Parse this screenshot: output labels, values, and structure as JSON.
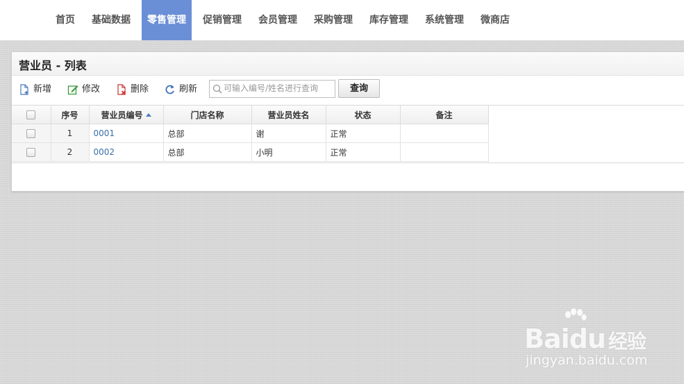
{
  "nav": {
    "items": [
      "首页",
      "基础数据",
      "零售管理",
      "促销管理",
      "会员管理",
      "采购管理",
      "库存管理",
      "系统管理",
      "微商店"
    ],
    "active_index": 2,
    "active_color": "#6a8fd6"
  },
  "panel": {
    "title": "营业员 - 列表"
  },
  "toolbar": {
    "add_label": "新增",
    "edit_label": "修改",
    "delete_label": "删除",
    "refresh_label": "刷新",
    "search_placeholder": "可输入编号/姓名进行查询",
    "search_value": "",
    "query_label": "查询"
  },
  "icons": {
    "add": "file-plus-icon",
    "edit": "edit-icon",
    "delete": "file-delete-icon",
    "refresh": "refresh-icon",
    "search": "search-icon"
  },
  "table": {
    "columns": [
      "序号",
      "营业员编号",
      "门店名称",
      "营业员姓名",
      "状态",
      "备注"
    ],
    "sorted_column": "营业员编号",
    "sort_direction": "ascending",
    "rows": [
      {
        "index": "1",
        "code": "0001",
        "store": "总部",
        "name": "谢",
        "status": "正常",
        "remark": ""
      },
      {
        "index": "2",
        "code": "0002",
        "store": "总部",
        "name": "小明",
        "status": "正常",
        "remark": ""
      }
    ]
  },
  "watermark": {
    "logo_text": "Bai",
    "logo_text2": "du",
    "logo_cn": "经验",
    "url": "jingyan.baidu.com"
  }
}
